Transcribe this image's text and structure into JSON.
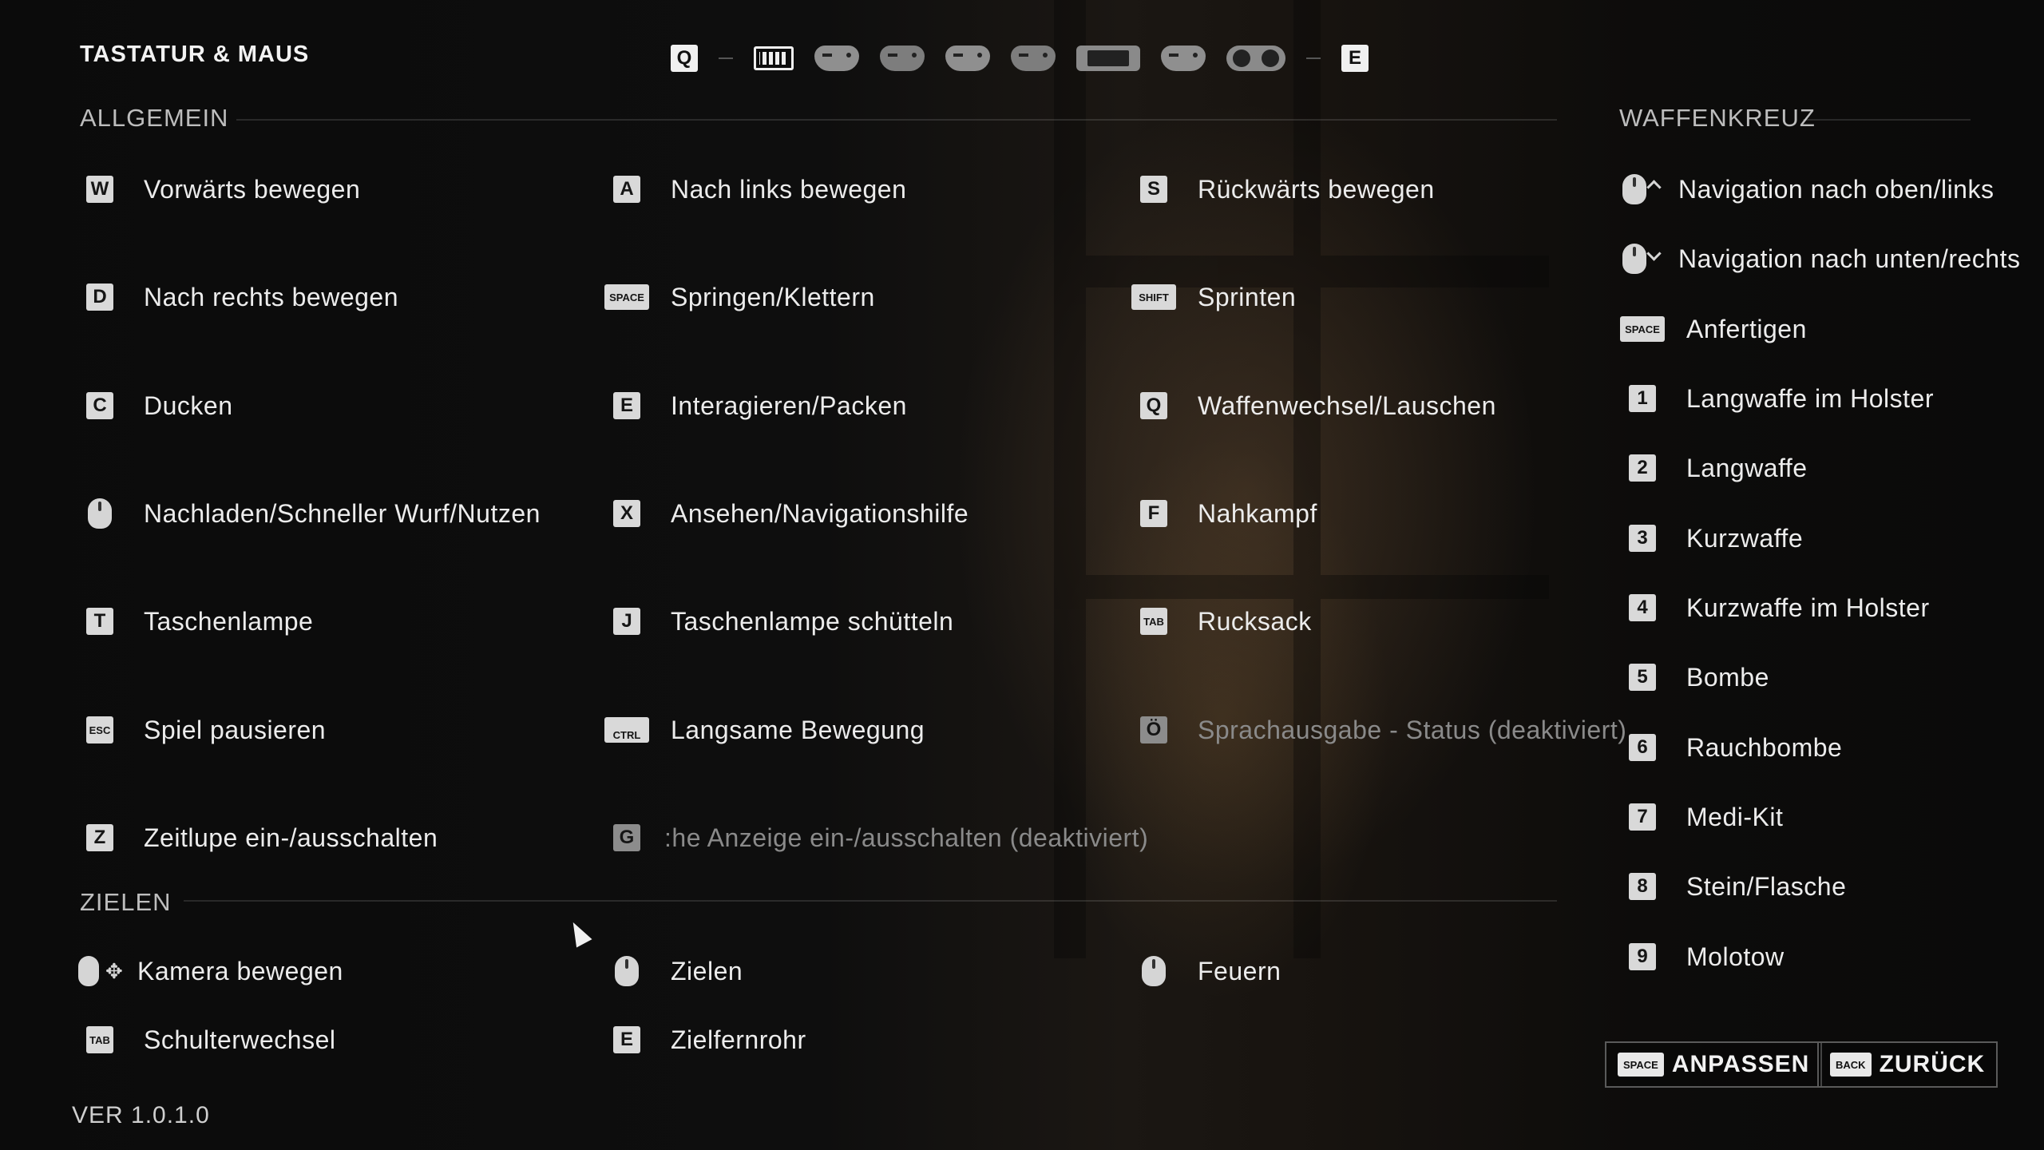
{
  "header": {
    "title": "TASTATUR & MAUS",
    "left_bumper": "Q",
    "right_bumper": "E",
    "devices": [
      "keyboard-icon",
      "gamepad-icon",
      "gamepad-icon",
      "gamepad-icon",
      "gamepad-icon",
      "switch-icon",
      "gamepad-icon",
      "joycon-icon"
    ]
  },
  "sections": {
    "general": "ALLGEMEIN",
    "aim": "ZIELEN",
    "weapon_wheel": "WAFFENKREUZ"
  },
  "general": [
    {
      "key": "W",
      "label": "Vorwärts bewegen"
    },
    {
      "key": "A",
      "label": "Nach links bewegen"
    },
    {
      "key": "S",
      "label": "Rückwärts bewegen"
    },
    {
      "key": "D",
      "label": "Nach rechts bewegen"
    },
    {
      "key": "SPACE",
      "label": "Springen/Klettern"
    },
    {
      "key": "SHIFT",
      "label": "Sprinten"
    },
    {
      "key": "C",
      "label": "Ducken"
    },
    {
      "key": "E",
      "label": "Interagieren/Packen"
    },
    {
      "key": "Q",
      "label": "Waffenwechsel/Lauschen"
    },
    {
      "key": "mouse-middle",
      "label": "Nachladen/Schneller Wurf/Nutzen"
    },
    {
      "key": "X",
      "label": "Ansehen/Navigationshilfe"
    },
    {
      "key": "F",
      "label": "Nahkampf"
    },
    {
      "key": "T",
      "label": "Taschenlampe"
    },
    {
      "key": "J",
      "label": "Taschenlampe schütteln"
    },
    {
      "key": "TAB",
      "label": "Rucksack"
    },
    {
      "key": "ESC",
      "label": "Spiel pausieren"
    },
    {
      "key": "CTRL",
      "label": "Langsame Bewegung"
    },
    {
      "key": "Ö",
      "label": "Sprachausgabe - Status (deaktiviert)"
    },
    {
      "key": "Z",
      "label": "Zeitlupe ein-/ausschalten"
    },
    {
      "key": "G",
      "label": ":he Anzeige ein-/ausschalten (deaktiviert)"
    }
  ],
  "aim": [
    {
      "key": "mouse-move",
      "label": "Kamera bewegen"
    },
    {
      "key": "mouse-right",
      "label": "Zielen"
    },
    {
      "key": "mouse-left",
      "label": "Feuern"
    },
    {
      "key": "TAB",
      "label": "Schulterwechsel"
    },
    {
      "key": "E",
      "label": "Zielfernrohr"
    }
  ],
  "weapon_wheel": [
    {
      "key": "mouse-wheel-up",
      "label": "Navigation nach oben/links"
    },
    {
      "key": "mouse-wheel-down",
      "label": "Navigation nach unten/rechts"
    },
    {
      "key": "SPACE",
      "label": "Anfertigen"
    },
    {
      "key": "1",
      "label": "Langwaffe im Holster"
    },
    {
      "key": "2",
      "label": "Langwaffe"
    },
    {
      "key": "3",
      "label": "Kurzwaffe"
    },
    {
      "key": "4",
      "label": "Kurzwaffe im Holster"
    },
    {
      "key": "5",
      "label": "Bombe"
    },
    {
      "key": "6",
      "label": "Rauchbombe"
    },
    {
      "key": "7",
      "label": "Medi-Kit"
    },
    {
      "key": "8",
      "label": "Stein/Flasche"
    },
    {
      "key": "9",
      "label": "Molotow"
    }
  ],
  "footer": {
    "version": "VER 1.0.1.0",
    "customize_key": "SPACE",
    "customize_label": "ANPASSEN",
    "back_key": "BACK",
    "back_label": "ZURÜCK"
  }
}
